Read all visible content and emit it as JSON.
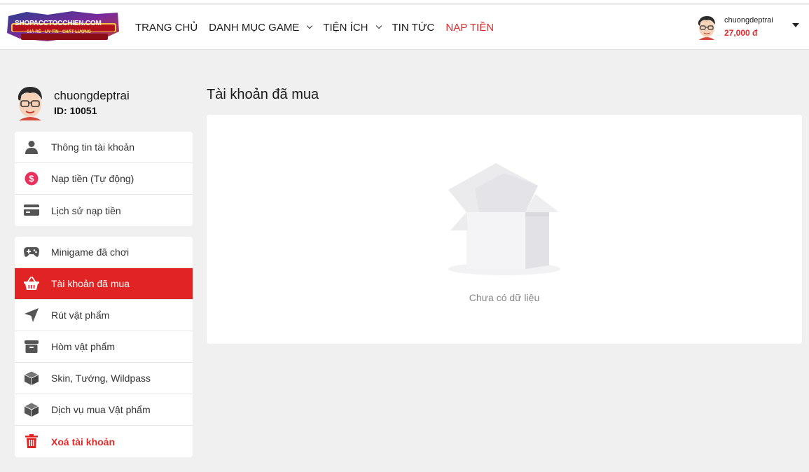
{
  "header": {
    "logo": {
      "title": "SHOPACCTOCCHIEN.COM",
      "tagline": "GIÁ RẺ - UY TÍN - CHẤT LƯỢNG"
    },
    "nav": [
      {
        "label": "TRANG CHỦ",
        "has_dropdown": false,
        "highlight": false
      },
      {
        "label": "DANH MỤC GAME",
        "has_dropdown": true,
        "highlight": false
      },
      {
        "label": "TIỆN ÍCH",
        "has_dropdown": true,
        "highlight": false
      },
      {
        "label": "TIN TỨC",
        "has_dropdown": false,
        "highlight": false
      },
      {
        "label": "NẠP TIỀN",
        "has_dropdown": false,
        "highlight": true
      }
    ],
    "user": {
      "name": "chuongdeptrai",
      "balance": "27,000 đ"
    }
  },
  "sidebar": {
    "profile": {
      "name": "chuongdeptrai",
      "id": "ID: 10051"
    },
    "group1": [
      {
        "label": "Thông tin tài khoản",
        "icon": "user-icon"
      },
      {
        "label": "Nạp tiền (Tự động)",
        "icon": "dollar-circle-icon"
      },
      {
        "label": "Lịch sử nạp tiền",
        "icon": "credit-card-icon"
      }
    ],
    "group2": [
      {
        "label": "Minigame đã chơi",
        "icon": "gamepad-icon"
      },
      {
        "label": "Tài khoản đã mua",
        "icon": "basket-icon",
        "active": true
      },
      {
        "label": "Rút vật phẩm",
        "icon": "send-icon"
      },
      {
        "label": "Hòm vật phẩm",
        "icon": "archive-box-icon"
      },
      {
        "label": "Skin, Tướng, Wildpass",
        "icon": "cube-icon"
      },
      {
        "label": "Dịch vụ mua Vật phẩm",
        "icon": "cube-icon"
      },
      {
        "label": "Xoá tài khoản",
        "icon": "trash-icon",
        "danger": true
      }
    ]
  },
  "main": {
    "title": "Tài khoản đã mua",
    "empty_text": "Chưa có dữ liệu"
  },
  "colors": {
    "accent": "#e02424",
    "background": "#f0f0f0",
    "panel": "#ffffff"
  }
}
